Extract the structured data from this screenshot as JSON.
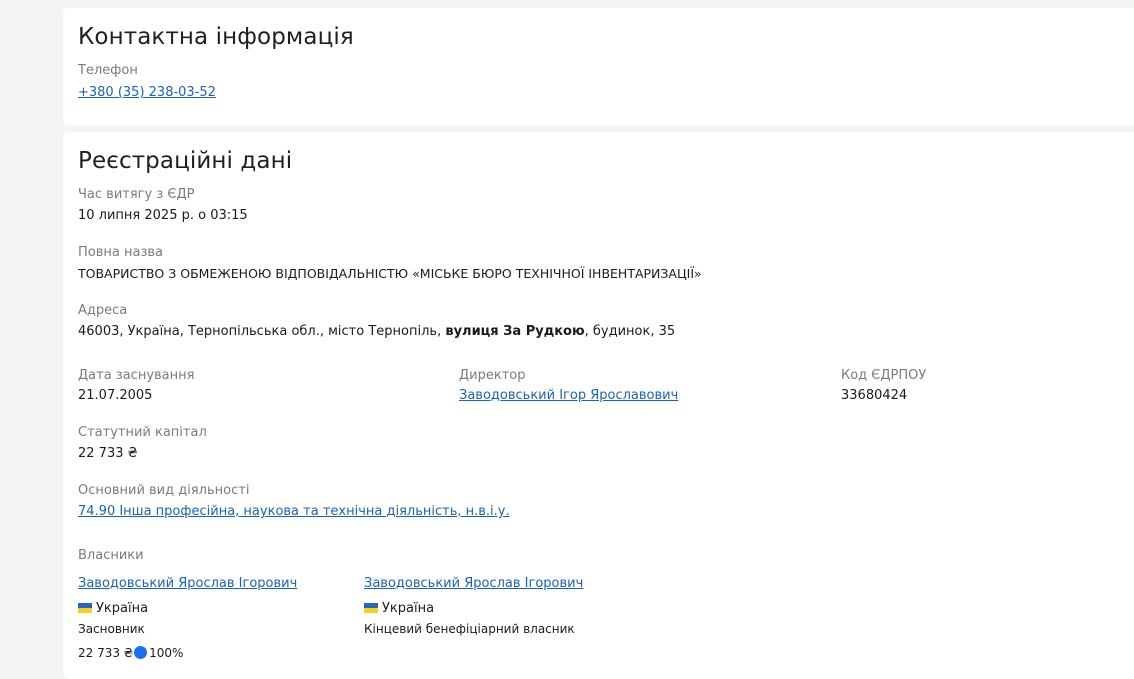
{
  "contact": {
    "title": "Контактна інформація",
    "phone_label": "Телефон",
    "phone_value": "+380 (35) 238-03-52"
  },
  "registration": {
    "title": "Реєстраційні дані",
    "extract_time_label": "Час витягу з ЄДР",
    "extract_time_value": "10 липня 2025 р. о 03:15",
    "full_name_label": "Повна назва",
    "full_name_value": "ТОВАРИСТВО З ОБМЕЖЕНОЮ ВІДПОВІДАЛЬНІСТЮ «МІСЬКЕ БЮРО ТЕХНІЧНОЇ ІНВЕНТАРИЗАЦІЇ»",
    "address_label": "Адреса",
    "address_prefix": "46003, Україна, Тернопільська обл., місто Тернопіль, ",
    "address_street": "вулиця За Рудкою",
    "address_suffix": ", будинок, 35",
    "founded_label": "Дата заснування",
    "founded_value": "21.07.2005",
    "director_label": "Директор",
    "director_value": "Заводовський Ігор Ярославович",
    "edrpou_label": "Код ЄДРПОУ",
    "edrpou_value": "33680424",
    "capital_label": "Статутний капітал",
    "capital_value": "22 733 ₴",
    "activity_label": "Основний вид діяльності",
    "activity_value": "74.90 Інша професійна, наукова та технічна діяльність, н.в.і.у.",
    "owners_label": "Власники",
    "owners": [
      {
        "name": "Заводовський Ярослав Ігорович",
        "country": "Україна",
        "role": "Засновник",
        "amount": "22 733 ₴",
        "share": "100%"
      },
      {
        "name": "Заводовський Ярослав Ігорович",
        "country": "Україна",
        "role": "Кінцевий бенефіціарний власник"
      }
    ]
  },
  "colors": {
    "link": "#1a63b8",
    "label": "#7b7b7b",
    "flag_blue": "#2762c9",
    "flag_yellow": "#f7cf1d",
    "share_dot": "#1b6ef3"
  },
  "icons": [
    "ukraine-flag-icon",
    "share-dot-icon"
  ]
}
